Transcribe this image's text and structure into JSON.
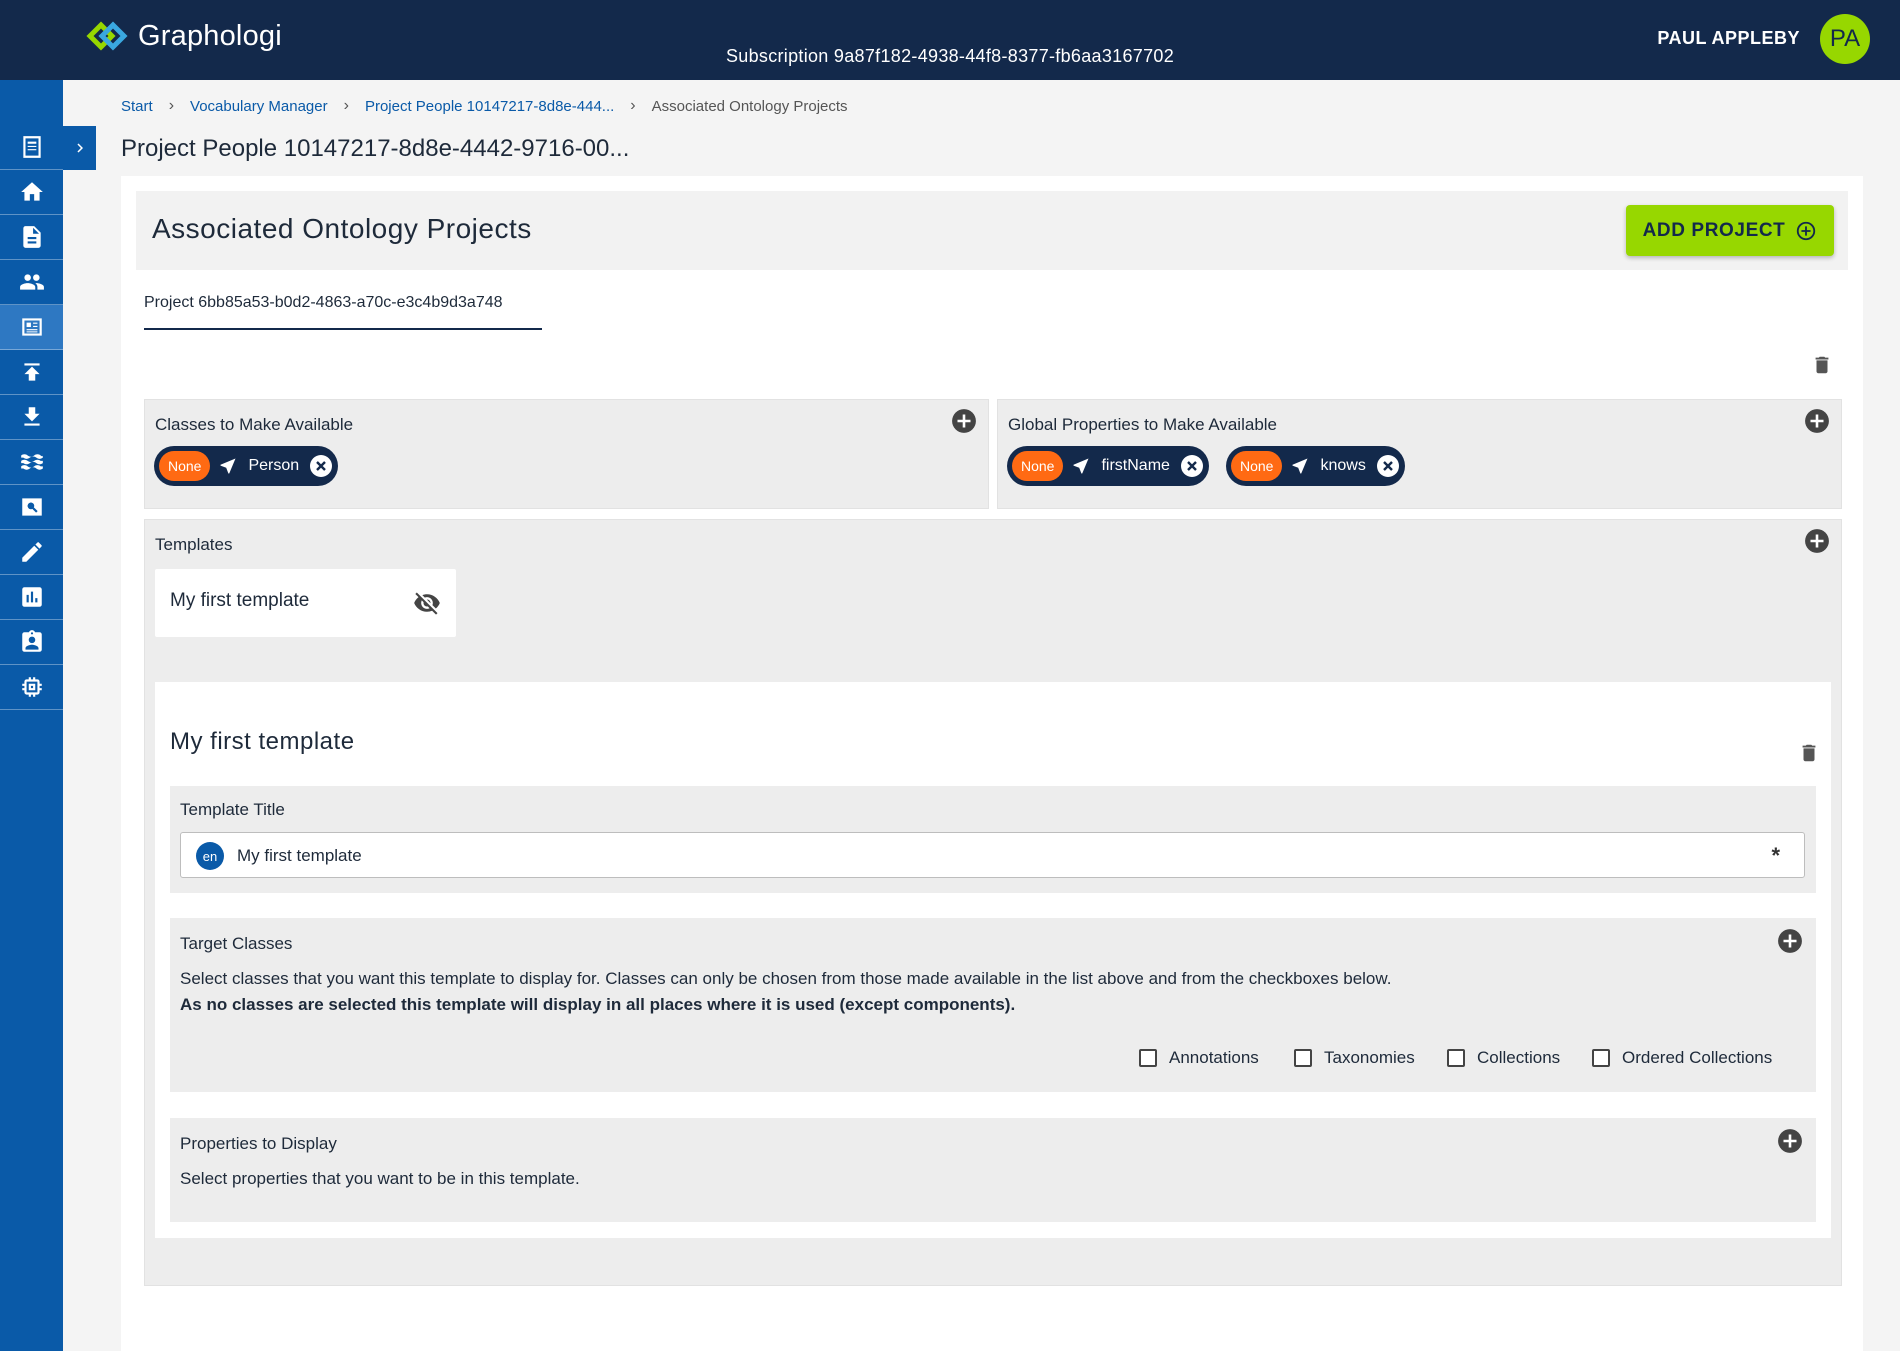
{
  "header": {
    "brand": "Graphologi",
    "subscription": "Subscription 9a87f182-4938-44f8-8377-fb6aa3167702",
    "user_name": "PAUL APPLEBY",
    "avatar_initials": "PA"
  },
  "sidebar": {
    "items": [
      {
        "icon": "notes-icon"
      },
      {
        "icon": "home-icon"
      },
      {
        "icon": "document-icon"
      },
      {
        "icon": "people-icon"
      },
      {
        "icon": "vocabulary-icon",
        "active": true
      },
      {
        "icon": "upload-icon"
      },
      {
        "icon": "download-icon"
      },
      {
        "icon": "waves-icon"
      },
      {
        "icon": "search-icon"
      },
      {
        "icon": "edit-icon"
      },
      {
        "icon": "chart-icon"
      },
      {
        "icon": "badge-icon"
      },
      {
        "icon": "chip-icon"
      }
    ]
  },
  "breadcrumb": {
    "items": [
      "Start",
      "Vocabulary Manager",
      "Project People 10147217-8d8e-444...",
      "Associated Ontology Projects"
    ]
  },
  "page_title": "Project People 10147217-8d8e-4442-9716-00...",
  "section": {
    "title": "Associated Ontology Projects",
    "add_project_label": "ADD PROJECT"
  },
  "tab": {
    "label": "Project 6bb85a53-b0d2-4863-a70c-e3c4b9d3a748"
  },
  "classes_card": {
    "label": "Classes to Make Available",
    "chips": [
      {
        "badge": "None",
        "label": "Person"
      }
    ]
  },
  "properties_card": {
    "label": "Global Properties to Make Available",
    "chips": [
      {
        "badge": "None",
        "label": "firstName"
      },
      {
        "badge": "None",
        "label": "knows"
      }
    ]
  },
  "templates_card": {
    "label": "Templates",
    "tile_label": "My first template"
  },
  "editor": {
    "title": "My first template",
    "template_title_label": "Template Title",
    "lang": "en",
    "template_title_value": "My first template",
    "required_mark": "*",
    "target_classes_label": "Target Classes",
    "target_help": "Select classes that you want this template to display for. Classes can only be chosen from those made available in the list above and from the checkboxes below.",
    "target_help_bold": "As no classes are selected this template will display in all places where it is used (except components).",
    "checkboxes": [
      "Annotations",
      "Taxonomies",
      "Collections",
      "Ordered Collections"
    ],
    "properties_label": "Properties to Display",
    "properties_help": "Select properties that you want to be in this template."
  },
  "colors": {
    "header_bg": "#13294b",
    "sidebar_bg": "#0a5aa8",
    "accent_green": "#97d700",
    "badge_orange": "#ff6a13",
    "chip_navy": "#13294b"
  }
}
